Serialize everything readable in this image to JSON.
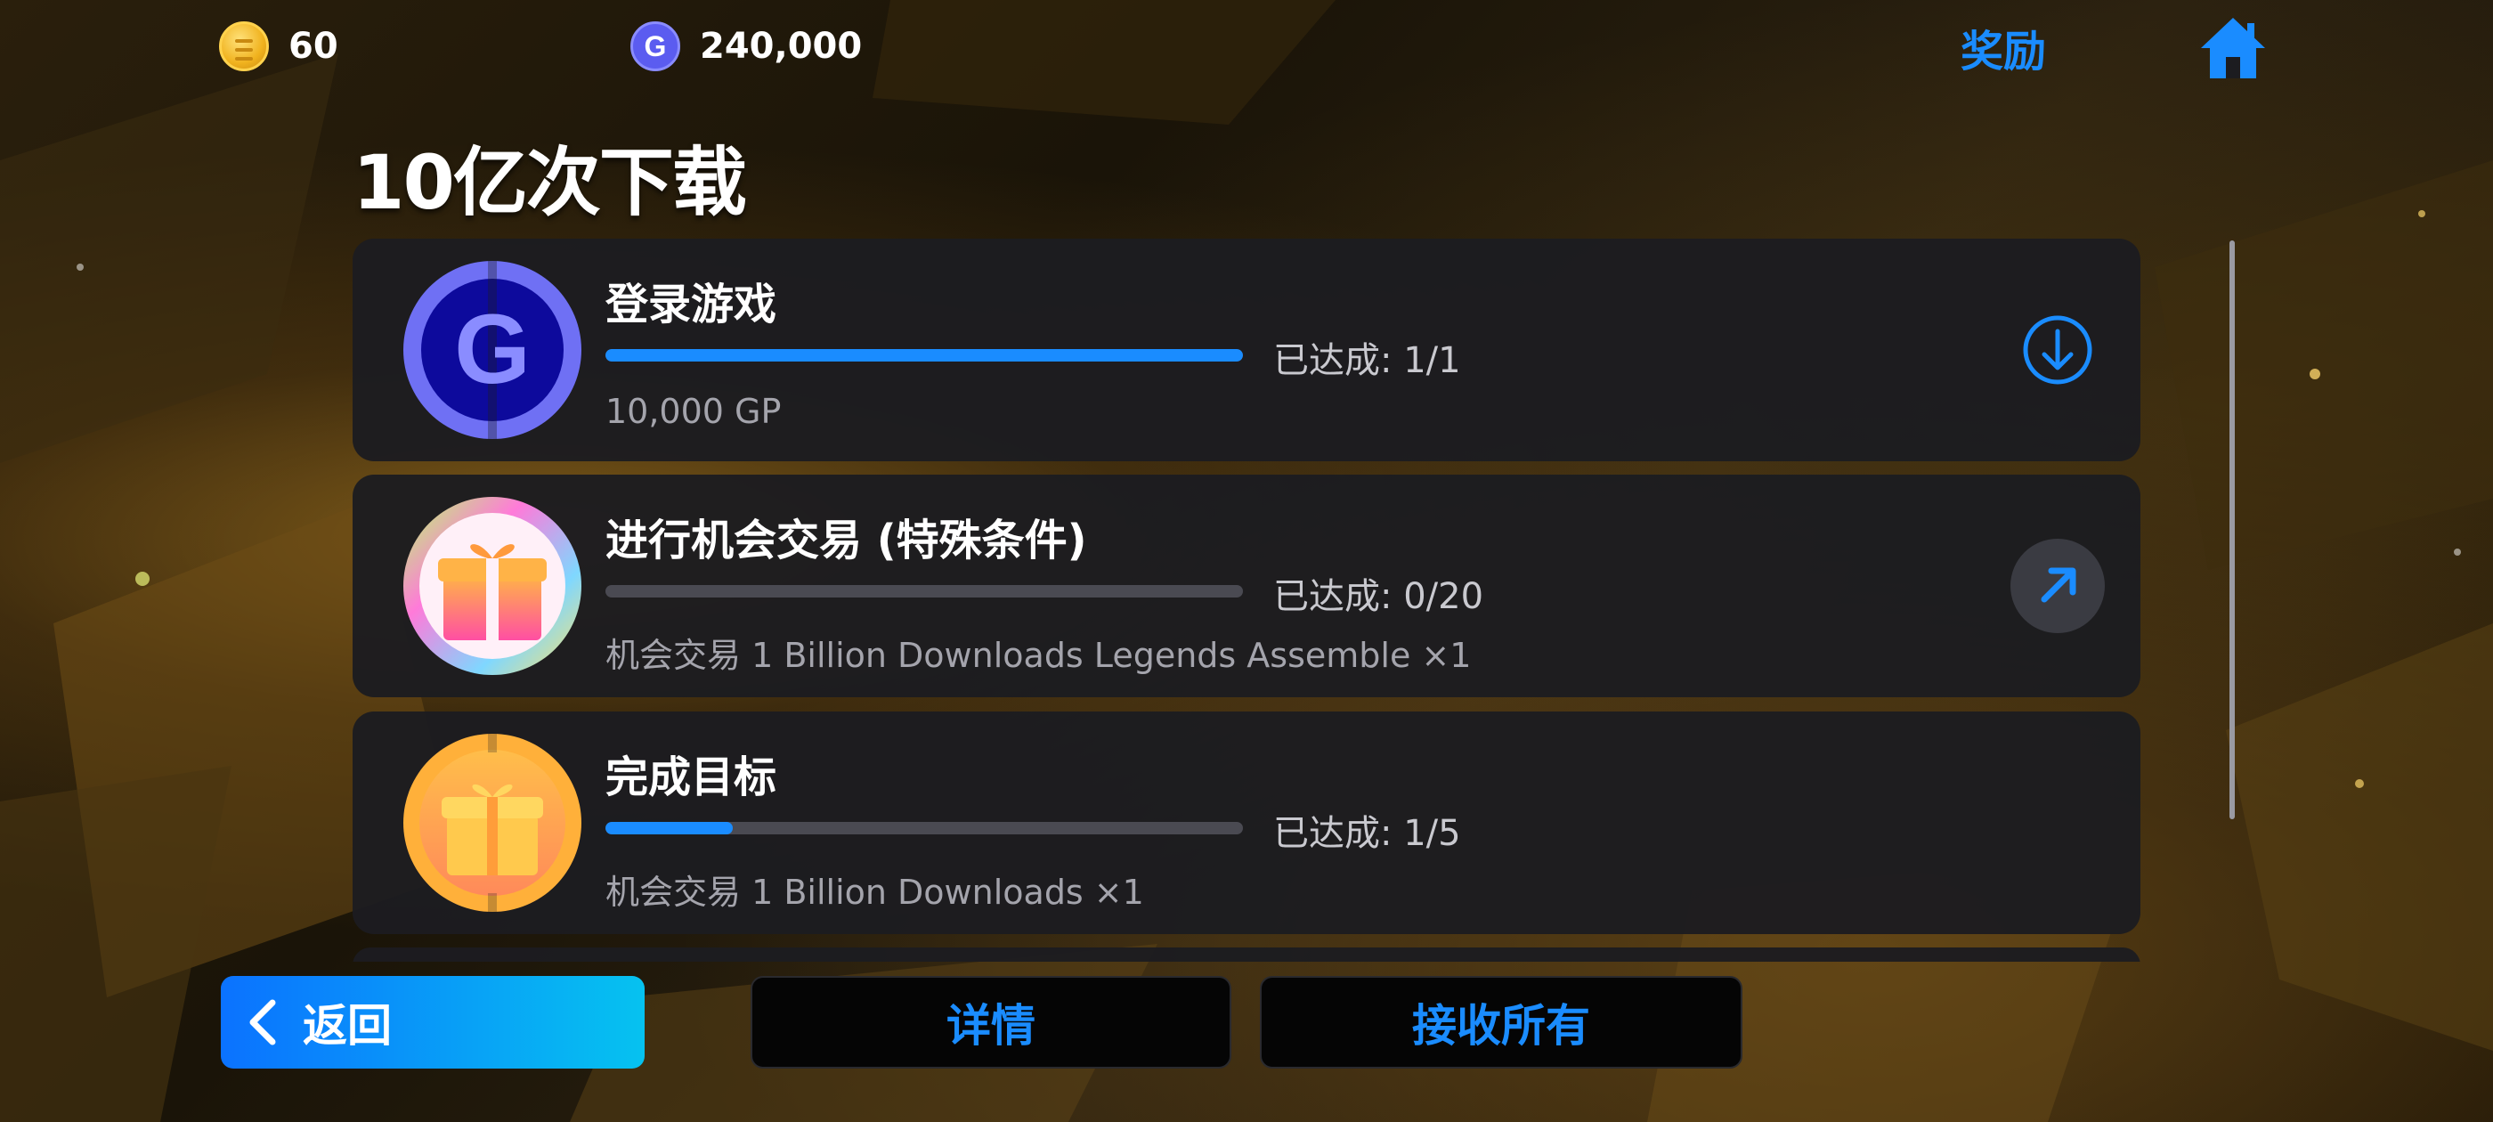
{
  "header": {
    "coins": "60",
    "gp": "240,000",
    "rewards_tab": "奖励",
    "page_title": "10亿次下载"
  },
  "missions": [
    {
      "name": "登录游戏",
      "progress_label": "已达成: 1/1",
      "progress": 1.0,
      "reward": "10,000 GP",
      "icon": "gp-coin-icon",
      "action": "claim-download-icon"
    },
    {
      "name": "进行机会交易 (特殊条件)",
      "progress_label": "已达成: 0/20",
      "progress": 0.0,
      "reward": "机会交易 1 Billion Downloads Legends Assemble ×1",
      "icon": "rainbow-gift-icon",
      "action": "go-arrow-icon"
    },
    {
      "name": "完成目标",
      "progress_label": "已达成: 1/5",
      "progress": 0.2,
      "reward": "机会交易 1 Billion Downloads ×1",
      "icon": "gold-gift-icon",
      "action": ""
    }
  ],
  "footer": {
    "back_label": "返回",
    "details_label": "详情",
    "claim_all_label": "接收所有"
  },
  "colors": {
    "accent": "#1a8cff",
    "card_bg": "#1c1c20",
    "track": "#4a4a52"
  }
}
